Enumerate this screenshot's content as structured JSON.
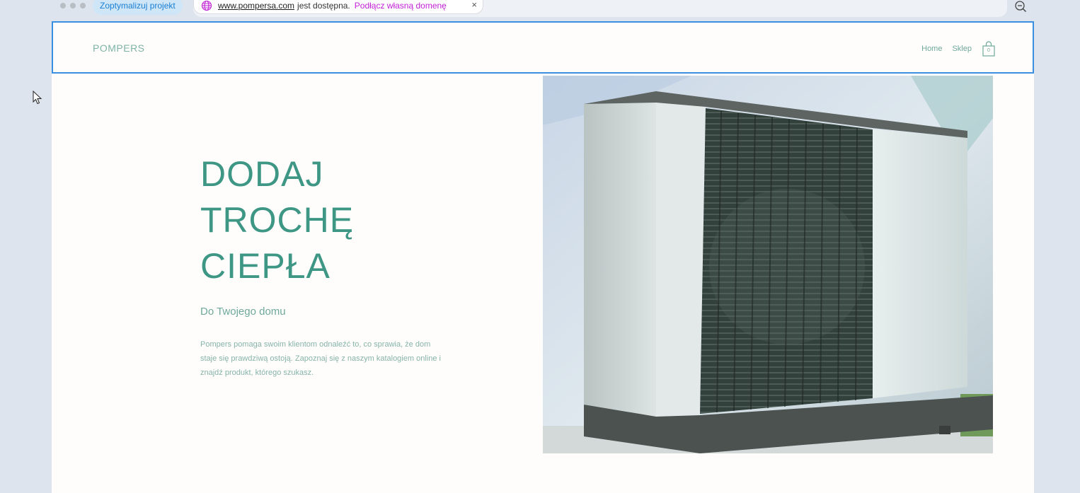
{
  "editor": {
    "optimize_label": "Zoptymalizuj projekt",
    "domain_url": "www.pompersa.com",
    "domain_status": "jest dostępna.",
    "connect_label": "Podłącz własną domenę",
    "close_symbol": "×"
  },
  "site": {
    "logo": "POMPERS",
    "nav": {
      "home": "Home",
      "shop": "Sklep",
      "cart_count": "0"
    },
    "hero": {
      "title_lines": [
        "DODAJ",
        "TROCHĘ",
        "CIEPŁA"
      ],
      "subtitle": "Do Twojego domu",
      "description": "Pompers pomaga swoim klientom odnaleźć to, co sprawia, że dom staje się prawdziwą ostoją. Zapoznaj się z naszym katalogiem online i znajdź produkt, którego szukasz."
    }
  },
  "colors": {
    "accent": "#3e9684",
    "selection": "#3b8fe0",
    "connect_link": "#c21fd6",
    "optimize_bg": "#cfe6f8"
  },
  "icons": {
    "globe": "globe-icon",
    "close": "close-icon",
    "zoom": "zoom-out-icon",
    "cart": "shopping-bag-icon",
    "cursor": "mouse-cursor-icon"
  }
}
